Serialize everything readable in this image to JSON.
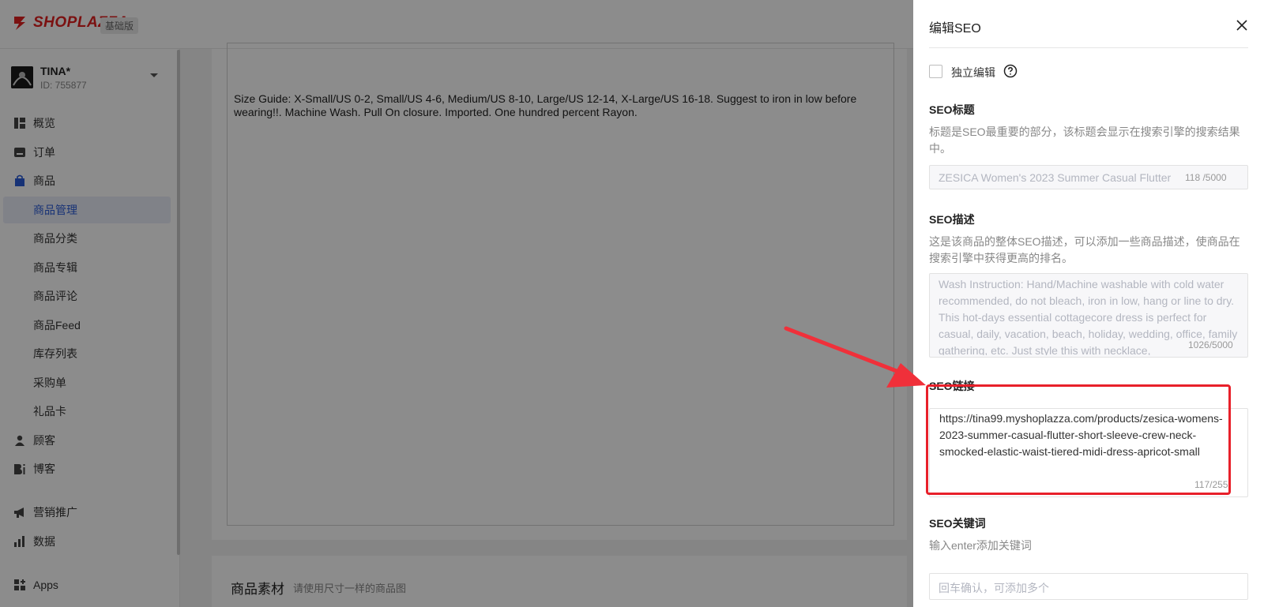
{
  "brand": {
    "logo_text": "SHOPLAZZA",
    "plan_badge": "基础版",
    "brand_color": "#e02020"
  },
  "store": {
    "name": "TINA*",
    "id_label": "ID: 755877"
  },
  "sidebar": {
    "items": [
      {
        "label": "概览",
        "icon": "overview-icon"
      },
      {
        "label": "订单",
        "icon": "orders-icon"
      },
      {
        "label": "商品",
        "icon": "products-icon"
      },
      {
        "label": "商品管理"
      },
      {
        "label": "商品分类"
      },
      {
        "label": "商品专辑"
      },
      {
        "label": "商品评论"
      },
      {
        "label": "商品Feed"
      },
      {
        "label": "库存列表"
      },
      {
        "label": "采购单"
      },
      {
        "label": "礼品卡"
      },
      {
        "label": "顾客",
        "icon": "customers-icon"
      },
      {
        "label": "博客",
        "icon": "blog-icon"
      },
      {
        "label": "营销推广",
        "icon": "marketing-icon"
      },
      {
        "label": "数据",
        "icon": "analytics-icon"
      },
      {
        "label": "Apps",
        "icon": "apps-icon"
      }
    ],
    "accent_color": "#2b5bd7"
  },
  "main": {
    "description_text": "Size Guide: X-Small/US 0-2, Small/US 4-6, Medium/US 8-10, Large/US 12-14, X-Large/US 16-18. Suggest to iron in low before wearing!!. Machine Wash. Pull On closure. Imported. One hundred percent Rayon.",
    "media_title": "商品素材",
    "media_hint": "请使用尺寸一样的商品图"
  },
  "drawer": {
    "title": "编辑SEO",
    "independent_edit_label": "独立编辑",
    "seo_title": {
      "label": "SEO标题",
      "desc": "标题是SEO最重要的部分，该标题会显示在搜索引擎的搜索结果中。",
      "value": "ZESICA Women's 2023 Summer Casual Flutter",
      "counter": "118 /5000"
    },
    "seo_desc": {
      "label": "SEO描述",
      "desc": "这是该商品的整体SEO描述，可以添加一些商品描述，使商品在搜索引擎中获得更高的排名。",
      "value": "Wash Instruction: Hand/Machine washable with cold water recommended, do not bleach, iron in low, hang or line to dry. This hot-days essential cottagecore dress is perfect for casual, daily, vacation, beach, holiday, wedding, office, family gathering, etc. Just style this with necklace,",
      "counter": "1026/5000"
    },
    "seo_link": {
      "label": "SEO链接",
      "value": "https://tina99.myshoplazza.com/products/zesica-womens-2023-summer-casual-flutter-short-sleeve-crew-neck-smocked-elastic-waist-tiered-midi-dress-apricot-small",
      "counter": "117/255"
    },
    "seo_keywords": {
      "label": "SEO关键词",
      "desc": "输入enter添加关键词",
      "placeholder": "回车确认，可添加多个"
    }
  },
  "annotation": {
    "color": "#e8202a"
  }
}
